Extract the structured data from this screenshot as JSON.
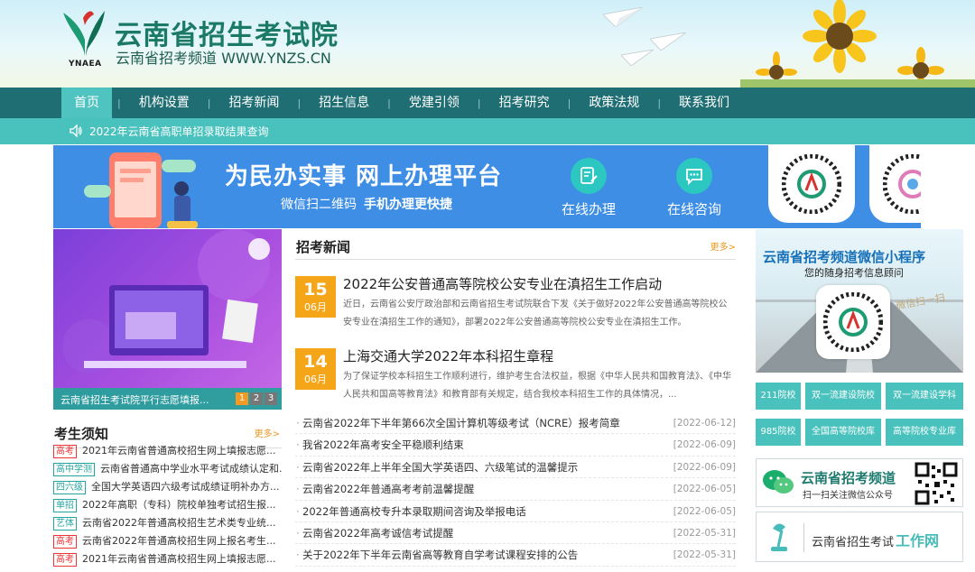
{
  "header": {
    "site_title": "云南省招生考试院",
    "site_subtitle": "云南省招考频道  WWW.YNZS.CN",
    "logo_abbr": "YNAEA"
  },
  "nav": {
    "items": [
      {
        "label": "首页",
        "active": true
      },
      {
        "label": "机构设置"
      },
      {
        "label": "招考新闻"
      },
      {
        "label": "招生信息"
      },
      {
        "label": "党建引领"
      },
      {
        "label": "招考研究"
      },
      {
        "label": "政策法规"
      },
      {
        "label": "联系我们"
      }
    ]
  },
  "notice": {
    "text": "2022年云南省高职单招录取结果查询"
  },
  "banner": {
    "title": "为民办实事  网上办理平台",
    "sub_normal": "微信扫二维码",
    "sub_bold": "手机办理更快捷",
    "service1": "在线办理",
    "service2": "在线咨询"
  },
  "promo": {
    "caption": "云南省招生考试院平行志愿填报...",
    "pages": [
      "1",
      "2",
      "3"
    ]
  },
  "ksxz": {
    "title": "考生须知",
    "more": "更多>",
    "items": [
      {
        "tag": "高考",
        "text": "2021年云南省普通高校招生网上填报志愿..."
      },
      {
        "tag": "高中学测",
        "text": "云南省普通高中学业水平考试成绩认定和..."
      },
      {
        "tag": "四六级",
        "text": "全国大学英语四六级考试成绩证明补办方..."
      },
      {
        "tag": "单招",
        "text": "2022年高职（专科）院校单独考试招生报..."
      },
      {
        "tag": "艺体",
        "text": "云南省2022年普通高校招生艺术类专业统..."
      },
      {
        "tag": "高考",
        "text": "云南省2022年普通高校招生网上报名考生..."
      },
      {
        "tag": "高考",
        "text": "2021年云南省普通高校招生网上填报志愿..."
      }
    ]
  },
  "news": {
    "title": "招考新闻",
    "more": "更多>",
    "featured": [
      {
        "day": "15",
        "month": "06月",
        "title": "2022年公安普通高等院校公安专业在滇招生工作启动",
        "desc": "近日，云南省公安厅政治部和云南省招生考试院联合下发《关于做好2022年公安普通高等院校公安专业在滇招生工作的通知》，部署2022年公安普通高等院校公安专业在滇招生工作。"
      },
      {
        "day": "14",
        "month": "06月",
        "title": "上海交通大学2022年本科招生章程",
        "desc": "为了保证学校本科招生工作顺利进行，维护考生合法权益，根据《中华人民共和国教育法》、《中华人民共和国高等教育法》和教育部有关规定，结合我校本科招生工作的具体情况，..."
      }
    ],
    "list": [
      {
        "text": "云南省2022年下半年第66次全国计算机等级考试（NCRE）报考简章",
        "date": "[2022-06-12]"
      },
      {
        "text": "我省2022年高考安全平稳顺利结束",
        "date": "[2022-06-09]"
      },
      {
        "text": "云南省2022年上半年全国大学英语四、六级笔试的温馨提示",
        "date": "[2022-06-09]"
      },
      {
        "text": "云南省2022年普通高考考前温馨提醒",
        "date": "[2022-06-05]"
      },
      {
        "text": "2022年普通高校专升本录取期间咨询及举报电话",
        "date": "[2022-06-05]"
      },
      {
        "text": "云南省2022年高考诚信考试提醒",
        "date": "[2022-05-31]"
      },
      {
        "text": "关于2022年下半年云南省高等教育自学考试课程安排的公告",
        "date": "[2022-05-31]"
      }
    ]
  },
  "right": {
    "mini_title": "云南省招考频道微信小程序",
    "mini_sub": "您的随身招考信息顾问",
    "mini_deco": "微信扫一扫",
    "quick_links": [
      "211院校",
      "双一流建设院校",
      "双一流建设学科",
      "985院校",
      "全国高等院校库",
      "高等院校专业库"
    ],
    "wechat_title": "云南省招考频道",
    "wechat_sub": "扫一扫关注微信公众号",
    "workweb_normal": "云南省招生考试",
    "workweb_strong": "工作网"
  },
  "colors": {
    "nav_bg": "#1f6e74",
    "accent_teal": "#49c1bd",
    "date_orange": "#f4a618",
    "banner_blue": "#3d8ee4",
    "promo_purple": "#8b45dd"
  },
  "icons": {
    "notice": "speaker-icon",
    "service1": "edit-document-icon",
    "service2": "chat-bubble-icon",
    "wechat": "wechat-icon",
    "workweb": "desk-lamp-icon"
  }
}
